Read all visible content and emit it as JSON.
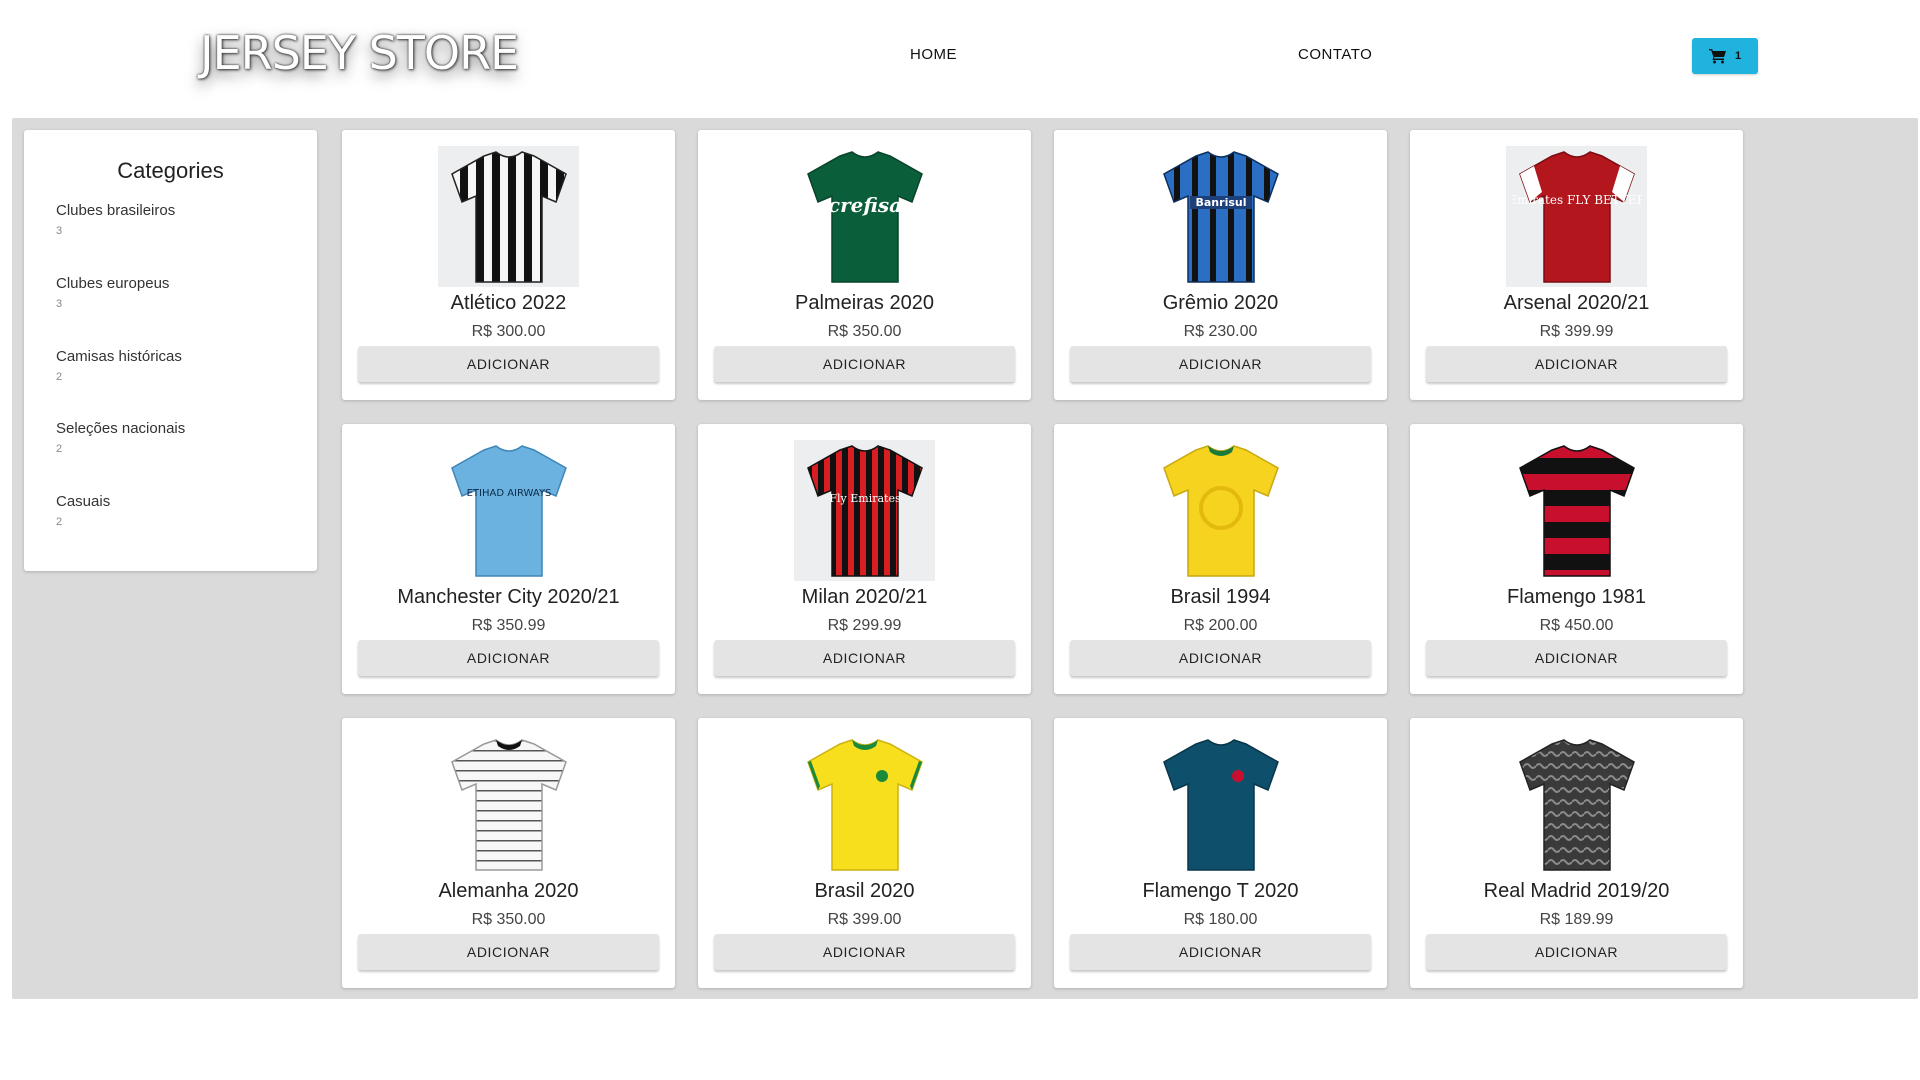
{
  "header": {
    "logo_text": "JERSEY STORE",
    "nav": [
      {
        "label": "HOME"
      },
      {
        "label": "CONTATO"
      }
    ],
    "cart": {
      "count": "1",
      "icon": "shopping-cart-icon",
      "color": "#1fb3de"
    }
  },
  "sidebar": {
    "title": "Categories",
    "categories": [
      {
        "name": "Clubes brasileiros",
        "count": "3"
      },
      {
        "name": "Clubes europeus",
        "count": "3"
      },
      {
        "name": "Camisas históricas",
        "count": "2"
      },
      {
        "name": "Seleções nacionais",
        "count": "2"
      },
      {
        "name": "Casuais",
        "count": "2"
      }
    ]
  },
  "products": [
    {
      "name": "Atlético 2022",
      "price": "R$ 300.00",
      "button": "ADICIONAR"
    },
    {
      "name": "Palmeiras 2020",
      "price": "R$ 350.00",
      "button": "ADICIONAR",
      "sponsor": "crefisa"
    },
    {
      "name": "Grêmio 2020",
      "price": "R$ 230.00",
      "button": "ADICIONAR",
      "sponsor": "Banrisul"
    },
    {
      "name": "Arsenal 2020/21",
      "price": "R$ 399.99",
      "button": "ADICIONAR",
      "sponsor": "Emirates FLY BETTER"
    },
    {
      "name": "Manchester City 2020/21",
      "price": "R$ 350.99",
      "button": "ADICIONAR",
      "sponsor": "ETIHAD AIRWAYS"
    },
    {
      "name": "Milan 2020/21",
      "price": "R$ 299.99",
      "button": "ADICIONAR",
      "sponsor": "Fly Emirates"
    },
    {
      "name": "Brasil 1994",
      "price": "R$ 200.00",
      "button": "ADICIONAR"
    },
    {
      "name": "Flamengo 1981",
      "price": "R$ 450.00",
      "button": "ADICIONAR"
    },
    {
      "name": "Alemanha 2020",
      "price": "R$ 350.00",
      "button": "ADICIONAR"
    },
    {
      "name": "Brasil 2020",
      "price": "R$ 399.00",
      "button": "ADICIONAR"
    },
    {
      "name": "Flamengo T 2020",
      "price": "R$ 180.00",
      "button": "ADICIONAR"
    },
    {
      "name": "Real Madrid 2019/20",
      "price": "R$ 189.99",
      "button": "ADICIONAR"
    }
  ]
}
